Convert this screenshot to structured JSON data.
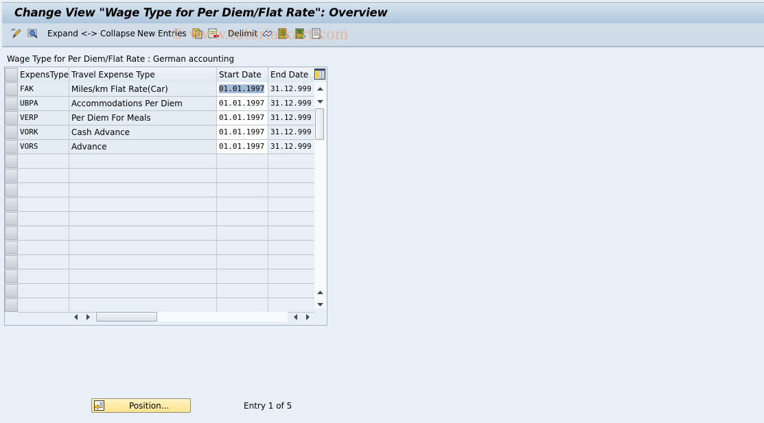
{
  "window": {
    "title": "Change View \"Wage Type for Per Diem/Flat Rate\": Overview"
  },
  "toolbar": {
    "items": [
      {
        "type": "icon",
        "name": "display-change-icon",
        "label": ""
      },
      {
        "type": "icon",
        "name": "find-icon",
        "label": ""
      },
      {
        "type": "text",
        "label": "Expand <-> Collapse"
      },
      {
        "type": "text",
        "label": "New Entries"
      },
      {
        "type": "icon",
        "name": "copy-as-icon",
        "label": ""
      },
      {
        "type": "icon",
        "name": "delete-icon",
        "label": ""
      },
      {
        "type": "text",
        "label": "Delimit"
      },
      {
        "type": "icon",
        "name": "undo-change-icon",
        "label": ""
      },
      {
        "type": "icon",
        "name": "select-all-icon",
        "label": ""
      },
      {
        "type": "icon",
        "name": "select-block-icon",
        "label": ""
      },
      {
        "type": "icon",
        "name": "deselect-all-icon",
        "label": ""
      }
    ],
    "expand_collapse_label": "Expand <-> Collapse",
    "new_entries_label": "New Entries",
    "delimit_label": "Delimit",
    "watermark": "© www.tutorialkart.com"
  },
  "section": {
    "label": "Wage Type for Per Diem/Flat Rate : German accounting"
  },
  "table": {
    "columns": [
      "ExpensType",
      "Travel Expense Type",
      "Start Date",
      "End Date"
    ],
    "rows": [
      {
        "expens_type": "FAK",
        "travel_expense_type": "Miles/km Flat Rate(Car)",
        "start_date": "01.01.1997",
        "end_date": "31.12.999",
        "selected": true
      },
      {
        "expens_type": "UBPA",
        "travel_expense_type": "Accommodations Per Diem",
        "start_date": "01.01.1997",
        "end_date": "31.12.999",
        "selected": false
      },
      {
        "expens_type": "VERP",
        "travel_expense_type": "Per Diem For Meals",
        "start_date": "01.01.1997",
        "end_date": "31.12.999",
        "selected": false
      },
      {
        "expens_type": "VORK",
        "travel_expense_type": "Cash Advance",
        "start_date": "01.01.1997",
        "end_date": "31.12.999",
        "selected": false
      },
      {
        "expens_type": "VORS",
        "travel_expense_type": "Advance",
        "start_date": "01.01.1997",
        "end_date": "31.12.999",
        "selected": false
      }
    ],
    "empty_rows": 11
  },
  "footer": {
    "position_button_label": "Position...",
    "entry_text": "Entry 1 of 5"
  },
  "colors": {
    "background": "#e8eff7",
    "titlebar": "#bcd0e3",
    "toolbar": "#d0dde8",
    "selection_highlight": "#a4bcd8",
    "position_button": "#fbe9a6"
  }
}
